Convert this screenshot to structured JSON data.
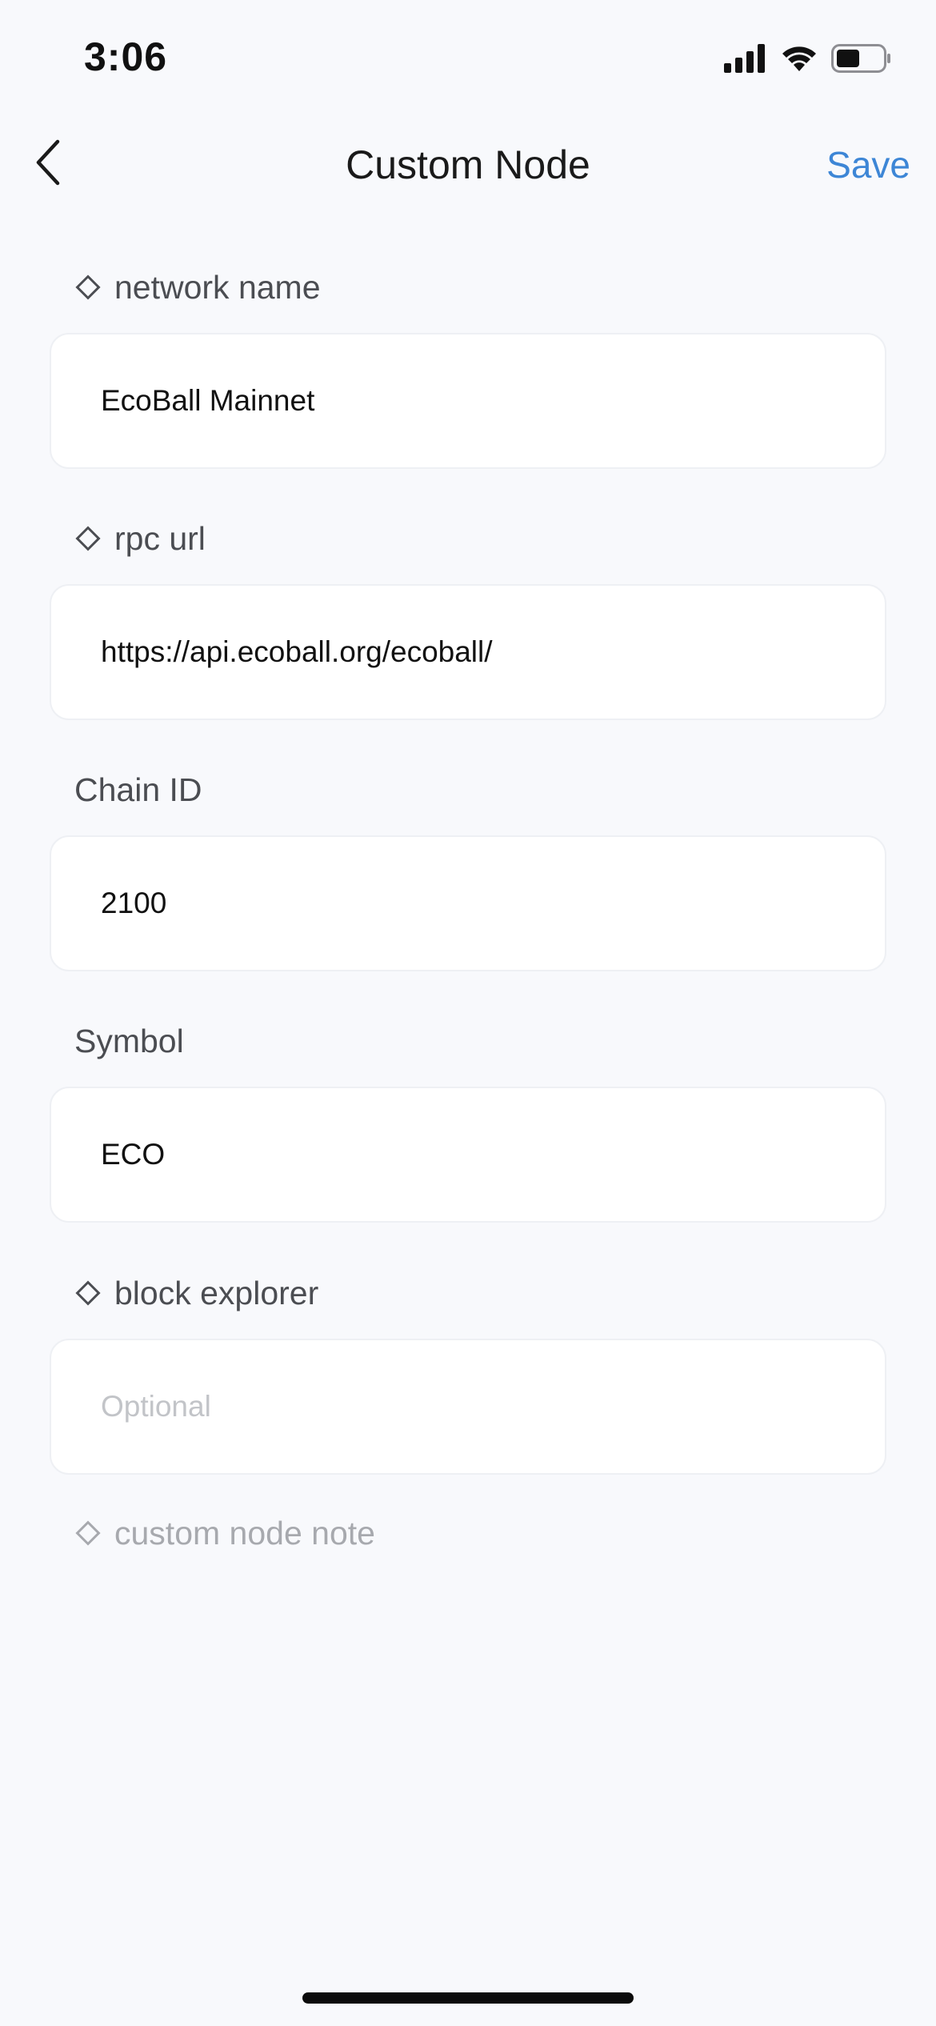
{
  "status_bar": {
    "time": "3:06"
  },
  "nav": {
    "title": "Custom Node",
    "save_label": "Save"
  },
  "form": {
    "network_name": {
      "label": "network name",
      "value": "EcoBall Mainnet",
      "required_marker": true
    },
    "rpc_url": {
      "label": "rpc url",
      "value": "https://api.ecoball.org/ecoball/",
      "required_marker": true
    },
    "chain_id": {
      "label": "Chain ID",
      "value": "2100"
    },
    "symbol": {
      "label": "Symbol",
      "value": "ECO"
    },
    "block_explorer": {
      "label": "block explorer",
      "value": "",
      "placeholder": "Optional",
      "required_marker": true
    },
    "note": {
      "label": "custom node note"
    }
  },
  "colors": {
    "accent": "#3d86d6",
    "background": "#f8f9fc",
    "label": "#4b4d52",
    "muted": "#a7a9ae",
    "placeholder": "#c2c4c8"
  },
  "icons": [
    "back-chevron-icon",
    "cellular-signal-icon",
    "wifi-icon",
    "battery-icon",
    "diamond-icon"
  ]
}
